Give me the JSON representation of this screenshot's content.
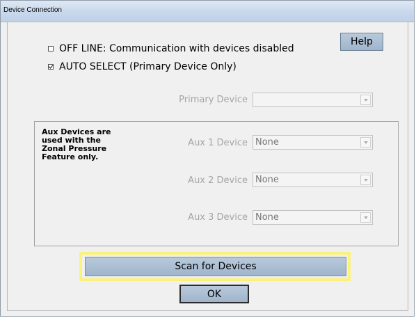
{
  "window": {
    "title": "Device Connection"
  },
  "options": {
    "offline_label": "OFF LINE: Communication with devices disabled",
    "offline_checked": false,
    "auto_select_label": "AUTO SELECT  (Primary Device Only)",
    "auto_select_checked": true
  },
  "help_button": {
    "label": "Help"
  },
  "primary": {
    "label": "Primary Device",
    "value": ""
  },
  "aux_group": {
    "note": "Aux Devices are used with the Zonal Pressure Feature only.",
    "devices": [
      {
        "label": "Aux 1 Device",
        "value": "None"
      },
      {
        "label": "Aux 2 Device",
        "value": "None"
      },
      {
        "label": "Aux 3 Device",
        "value": "None"
      }
    ]
  },
  "scan_button": {
    "label": "Scan for Devices"
  },
  "ok_button": {
    "label": "OK"
  },
  "colors": {
    "highlight": "#fbf27b",
    "button": "#a8bdd2",
    "disabled_text": "#a5a5a5"
  }
}
